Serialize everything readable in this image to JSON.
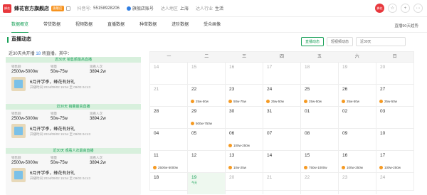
{
  "header": {
    "logo_text": "蜂花",
    "shop_name": "蜂花官方旗舰店",
    "shop_tag": "旗舰店",
    "account_label": "抖音号:",
    "account_value": "55158928206",
    "verify_label": "蓝V认证",
    "verify_badge": "旗舰店账号",
    "location_label": "达人地区",
    "location_value": "上海",
    "industry_label": "达人行业",
    "industry_value": "生活",
    "btn_follow": "☆",
    "btn_add": "+",
    "btn_menu": "⋯"
  },
  "tabs": [
    "数据概览",
    "带货数据",
    "视频数据",
    "直播数据",
    "种草数据",
    "进阶数据",
    "受众画像"
  ],
  "trend_link": "直播90天趋势",
  "section": {
    "title": "直播动态",
    "summary_prefix": "近30天共开播",
    "summary_count": "18",
    "summary_suffix": "场直播，其中：",
    "buttons": [
      "直播动态",
      "短视频动态"
    ],
    "period": "近30天"
  },
  "cards": [
    {
      "header": "近30天 销售额最高直播",
      "labels": [
        "销售额",
        "销量",
        "观看人次"
      ],
      "values": [
        "2500w-5000w",
        "50w-75w",
        "3894.2w"
      ],
      "product": "6月开学季，蜂花有好礼",
      "date": "开播时间 2024/09/02 15:54 至 09/03 04:43"
    },
    {
      "header": "近30天 销量最高直播",
      "labels": [
        "销售额",
        "销量",
        "观看人次"
      ],
      "values": [
        "2500w-5000w",
        "50w-75w",
        "3894.2w"
      ],
      "product": "6月开学季，蜂花有好礼",
      "date": "开播时间 2024/09/02 15:54 至 09/03 04:43"
    },
    {
      "header": "近30天 观看人次最高直播",
      "labels": [
        "销售额",
        "销量",
        "观看人次"
      ],
      "values": [
        "2500w-5000w",
        "50w-75w",
        "3894.2w"
      ],
      "product": "6月开学季，蜂花有好礼",
      "date": "开播时间 2024/09/02 15:54 至 09/03 04:43"
    }
  ],
  "calendar": {
    "weekdays": [
      "一",
      "二",
      "三",
      "四",
      "五",
      "六",
      "日"
    ],
    "rows": [
      [
        {
          "d": "14",
          "dim": true,
          "ev": ""
        },
        {
          "d": "15",
          "dim": true,
          "ev": ""
        },
        {
          "d": "16",
          "dim": true,
          "ev": ""
        },
        {
          "d": "17",
          "dim": true,
          "ev": ""
        },
        {
          "d": "18",
          "dim": true,
          "ev": ""
        },
        {
          "d": "19",
          "dim": true,
          "ev": ""
        },
        {
          "d": "20",
          "dim": true,
          "ev": ""
        }
      ],
      [
        {
          "d": "21",
          "dim": true,
          "ev": ""
        },
        {
          "d": "22",
          "ev": "25w-50w"
        },
        {
          "d": "23",
          "ev": "50w-75w"
        },
        {
          "d": "24",
          "ev": "25w-50w"
        },
        {
          "d": "25",
          "ev": "25w-50w"
        },
        {
          "d": "26",
          "ev": "25w-50w"
        },
        {
          "d": "27",
          "ev": "25w-50w"
        }
      ],
      [
        {
          "d": "28",
          "ev": ""
        },
        {
          "d": "29",
          "ev": "500w-750w"
        },
        {
          "d": "30",
          "ev": ""
        },
        {
          "d": "31",
          "ev": ""
        },
        {
          "d": "01",
          "ev": ""
        },
        {
          "d": "02",
          "ev": ""
        },
        {
          "d": "03",
          "ev": ""
        }
      ],
      [
        {
          "d": "04",
          "ev": ""
        },
        {
          "d": "05",
          "ev": ""
        },
        {
          "d": "06",
          "ev": "100w-250w"
        },
        {
          "d": "07",
          "ev": ""
        },
        {
          "d": "08",
          "ev": ""
        },
        {
          "d": "09",
          "ev": ""
        },
        {
          "d": "10",
          "ev": ""
        }
      ],
      [
        {
          "d": "11",
          "ev": "2500w-5000w"
        },
        {
          "d": "12",
          "ev": ""
        },
        {
          "d": "13",
          "ev": "10w-25w"
        },
        {
          "d": "14",
          "ev": ""
        },
        {
          "d": "15",
          "ev": "750w-1000w"
        },
        {
          "d": "16",
          "ev": "100w-250w"
        },
        {
          "d": "17",
          "ev": "100w-250w"
        }
      ],
      [
        {
          "d": "18",
          "ev": ""
        },
        {
          "d": "19",
          "today": true,
          "ev": "",
          "tick": "今天"
        },
        {
          "d": "20",
          "dim": true,
          "ev": ""
        },
        {
          "d": "21",
          "dim": true,
          "ev": ""
        },
        {
          "d": "22",
          "dim": true,
          "ev": ""
        },
        {
          "d": "23",
          "dim": true,
          "ev": ""
        },
        {
          "d": "24",
          "dim": true,
          "ev": ""
        }
      ]
    ]
  }
}
